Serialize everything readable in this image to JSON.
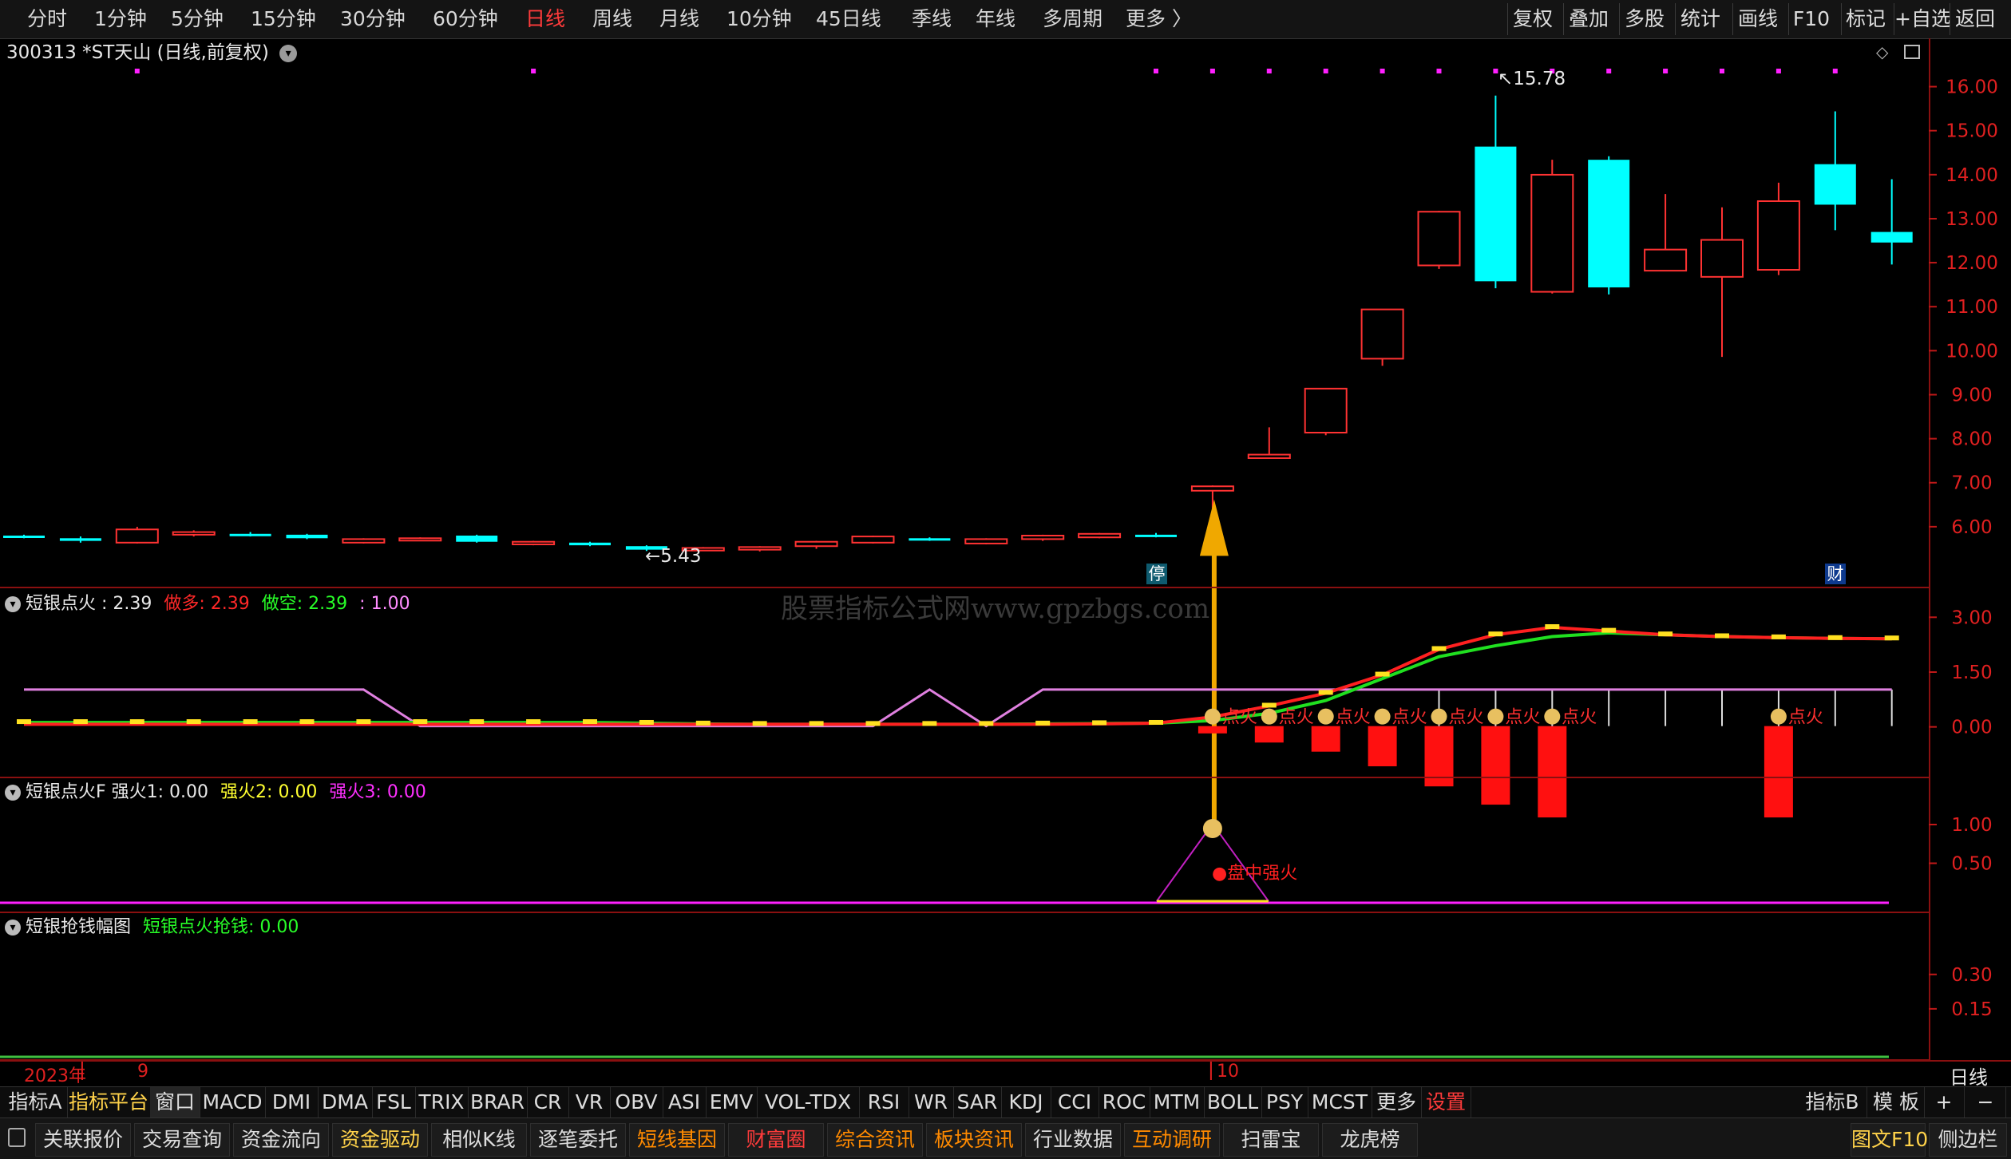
{
  "topbar": {
    "periods": [
      "分时",
      "1分钟",
      "5分钟",
      "15分钟",
      "30分钟",
      "60分钟",
      "日线",
      "周线",
      "月线",
      "10分钟",
      "45日线",
      "季线",
      "年线",
      "多周期",
      "更多 〉"
    ],
    "active_period": "日线",
    "tools": [
      "复权",
      "叠加",
      "多股",
      "统计",
      "画线",
      "F10",
      "标记",
      "+自选",
      "返回"
    ]
  },
  "stock_header": {
    "label": "300313 *ST天山 (日线,前复权)"
  },
  "price_panel": {
    "y_ticks": [
      "16.00",
      "15.00",
      "14.00",
      "13.00",
      "12.00",
      "11.00",
      "10.00",
      "9.00",
      "8.00",
      "7.00",
      "6.00"
    ],
    "high_label": "15.78",
    "low_label": "5.43",
    "limit_badge": "停",
    "finance_badge": "财",
    "watermark": "股票指标公式网www.gpzbgs.com"
  },
  "ind1": {
    "name": "短银点火 : 2.39",
    "long_label": "做多: 2.39",
    "short_label": "做空: 2.39",
    "third_label": ": 1.00",
    "y_ticks": [
      "3.00",
      "1.50",
      "0.00"
    ],
    "fire_label": "点火",
    "colors": {
      "long": "#ff2020",
      "short": "#20ff20",
      "third": "#ff80ff"
    }
  },
  "ind2": {
    "name": "短银点火F  强火1: 0.00",
    "s2": "强火2: 0.00",
    "s3": "强火3: 0.00",
    "y_ticks": [
      "1.00",
      "0.50"
    ],
    "signal_label": "盘中强火"
  },
  "ind3": {
    "name": "短银抢钱幅图",
    "value": "短银点火抢钱: 0.00",
    "y_ticks": [
      "0.30",
      "0.15"
    ]
  },
  "date_axis": {
    "year": "2023年",
    "month_9": "9",
    "month_10": "10",
    "period": "日线"
  },
  "indicator_tabs": [
    "指标A",
    "指标平台",
    "窗口",
    "MACD",
    "DMI",
    "DMA",
    "FSL",
    "TRIX",
    "BRAR",
    "CR",
    "VR",
    "OBV",
    "ASI",
    "EMV",
    "VOL-TDX",
    "RSI",
    "WR",
    "SAR",
    "KDJ",
    "CCI",
    "ROC",
    "MTM",
    "BOLL",
    "PSY",
    "MCST",
    "更多",
    "设置"
  ],
  "indicator_right": [
    "指标B",
    "模 板",
    "+",
    "−"
  ],
  "function_bar": [
    "关联报价",
    "交易查询",
    "资金流向",
    "资金驱动",
    "相似K线",
    "逐笔委托",
    "短线基因",
    "财富圈",
    "综合资讯",
    "板块资讯",
    "行业数据",
    "互动调研",
    "扫雷宝",
    "龙虎榜"
  ],
  "function_right": [
    "图文F10",
    "侧边栏"
  ],
  "colors": {
    "up": "#ff3232",
    "down": "#00ffff",
    "axis": "#8a1010",
    "magenta": "#ff20ff",
    "gold": "#f0a800"
  },
  "chart_data": {
    "type": "candlestick",
    "price_range": [
      5.0,
      16.5
    ],
    "candles": [
      {
        "o": 5.78,
        "c": 5.74,
        "h": 5.8,
        "l": 5.72
      },
      {
        "o": 5.72,
        "c": 5.66,
        "h": 5.76,
        "l": 5.62
      },
      {
        "o": 5.62,
        "c": 5.92,
        "h": 5.98,
        "l": 5.6
      },
      {
        "o": 5.8,
        "c": 5.86,
        "h": 5.9,
        "l": 5.76
      },
      {
        "o": 5.82,
        "c": 5.8,
        "h": 5.86,
        "l": 5.76
      },
      {
        "o": 5.8,
        "c": 5.72,
        "h": 5.82,
        "l": 5.7
      },
      {
        "o": 5.62,
        "c": 5.7,
        "h": 5.72,
        "l": 5.6
      },
      {
        "o": 5.7,
        "c": 5.72,
        "h": 5.74,
        "l": 5.68
      },
      {
        "o": 5.78,
        "c": 5.64,
        "h": 5.8,
        "l": 5.62
      },
      {
        "o": 5.58,
        "c": 5.64,
        "h": 5.66,
        "l": 5.56
      },
      {
        "o": 5.62,
        "c": 5.56,
        "h": 5.64,
        "l": 5.54
      },
      {
        "o": 5.54,
        "c": 5.46,
        "h": 5.56,
        "l": 5.43
      },
      {
        "o": 5.44,
        "c": 5.5,
        "h": 5.52,
        "l": 5.43
      },
      {
        "o": 5.46,
        "c": 5.52,
        "h": 5.54,
        "l": 5.42
      },
      {
        "o": 5.54,
        "c": 5.64,
        "h": 5.66,
        "l": 5.48
      },
      {
        "o": 5.62,
        "c": 5.76,
        "h": 5.78,
        "l": 5.6
      },
      {
        "o": 5.72,
        "c": 5.68,
        "h": 5.74,
        "l": 5.66
      },
      {
        "o": 5.6,
        "c": 5.7,
        "h": 5.72,
        "l": 5.58
      },
      {
        "o": 5.7,
        "c": 5.78,
        "h": 5.8,
        "l": 5.66
      },
      {
        "o": 5.74,
        "c": 5.82,
        "h": 5.84,
        "l": 5.72
      },
      {
        "o": 5.8,
        "c": 5.76,
        "h": 5.84,
        "l": 5.74
      },
      {
        "o": 6.8,
        "c": 6.9,
        "h": 6.92,
        "l": 6.4
      },
      {
        "o": 7.54,
        "c": 7.62,
        "h": 8.24,
        "l": 7.54
      },
      {
        "o": 8.12,
        "c": 9.12,
        "h": 9.12,
        "l": 8.06
      },
      {
        "o": 9.8,
        "c": 10.92,
        "h": 10.92,
        "l": 9.64
      },
      {
        "o": 11.92,
        "c": 13.14,
        "h": 13.16,
        "l": 11.84
      },
      {
        "o": 14.62,
        "c": 11.56,
        "h": 15.78,
        "l": 11.4
      },
      {
        "o": 11.32,
        "c": 13.98,
        "h": 14.32,
        "l": 11.28
      },
      {
        "o": 14.32,
        "c": 11.42,
        "h": 14.4,
        "l": 11.26
      },
      {
        "o": 11.8,
        "c": 12.28,
        "h": 13.54,
        "l": 11.8
      },
      {
        "o": 11.66,
        "c": 12.5,
        "h": 13.24,
        "l": 9.84
      },
      {
        "o": 11.82,
        "c": 13.38,
        "h": 13.8,
        "l": 11.7
      },
      {
        "o": 14.22,
        "c": 13.3,
        "h": 15.42,
        "l": 12.72
      },
      {
        "o": 12.68,
        "c": 12.44,
        "h": 13.88,
        "l": 11.94
      }
    ],
    "ind1_long": [
      0.05,
      0.05,
      0.05,
      0.05,
      0.05,
      0.05,
      0.05,
      0.05,
      0.05,
      0.05,
      0.05,
      0.05,
      0.05,
      0.05,
      0.05,
      0.05,
      0.05,
      0.05,
      0.05,
      0.06,
      0.08,
      0.25,
      0.55,
      0.9,
      1.4,
      2.1,
      2.5,
      2.7,
      2.6,
      2.5,
      2.45,
      2.42,
      2.4,
      2.39
    ],
    "ind1_short": [
      0.1,
      0.1,
      0.1,
      0.1,
      0.1,
      0.1,
      0.1,
      0.1,
      0.1,
      0.1,
      0.1,
      0.08,
      0.06,
      0.05,
      0.05,
      0.05,
      0.05,
      0.05,
      0.06,
      0.07,
      0.08,
      0.15,
      0.35,
      0.7,
      1.3,
      1.9,
      2.2,
      2.45,
      2.55,
      2.5,
      2.45,
      2.42,
      2.4,
      2.39
    ],
    "ind1_third": [
      1,
      1,
      1,
      1,
      1,
      1,
      1,
      0,
      0,
      0,
      0,
      0,
      0,
      0,
      0,
      0,
      1,
      0,
      1,
      1,
      1,
      1,
      1,
      1,
      1,
      1,
      1,
      1,
      1,
      1,
      1,
      1,
      1,
      1
    ],
    "ind1_bars": [
      0,
      0,
      0,
      0,
      0,
      0,
      0,
      0,
      0,
      0,
      0,
      0,
      0,
      0,
      0,
      0,
      0,
      0,
      0,
      0,
      0,
      -0.2,
      -0.45,
      -0.7,
      -1.1,
      -1.65,
      -2.15,
      -2.5,
      0,
      0,
      0,
      -2.5,
      0,
      0
    ],
    "ind2_values": [
      0,
      0,
      0,
      0,
      0,
      0,
      0,
      0,
      0,
      0,
      0,
      0,
      0,
      0,
      0,
      0,
      0,
      0,
      0,
      0,
      0,
      1,
      0,
      0,
      0,
      0,
      0,
      0,
      0,
      0,
      0,
      0,
      0,
      0
    ]
  }
}
